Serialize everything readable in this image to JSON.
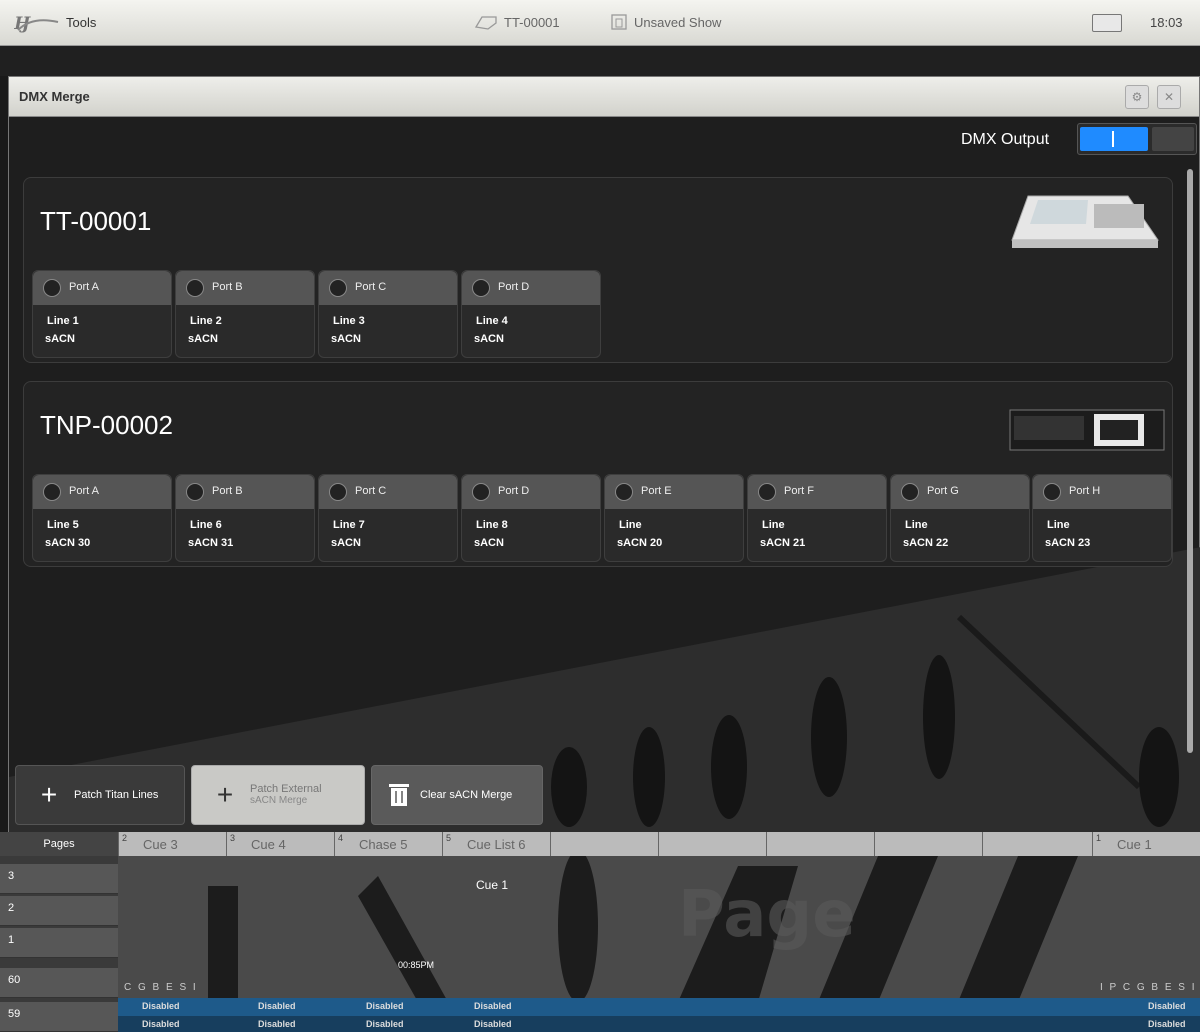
{
  "topbar": {
    "tools_label": "Tools",
    "console_name": "TT-00001",
    "show_name": "Unsaved Show",
    "clock": "18:03"
  },
  "window": {
    "title": "DMX Merge",
    "dmx_output_label": "DMX Output",
    "dmx_output_on": true
  },
  "devices": [
    {
      "name": "TT-00001",
      "ports": [
        {
          "port": "Port A",
          "line": "Line 1",
          "sub": "sACN"
        },
        {
          "port": "Port B",
          "line": "Line 2",
          "sub": "sACN"
        },
        {
          "port": "Port C",
          "line": "Line 3",
          "sub": "sACN"
        },
        {
          "port": "Port D",
          "line": "Line 4",
          "sub": "sACN"
        }
      ]
    },
    {
      "name": "TNP-00002",
      "ports": [
        {
          "port": "Port A",
          "line": "Line 5",
          "sub": "sACN 30"
        },
        {
          "port": "Port B",
          "line": "Line 6",
          "sub": "sACN 31"
        },
        {
          "port": "Port C",
          "line": "Line 7",
          "sub": "sACN"
        },
        {
          "port": "Port D",
          "line": "Line 8",
          "sub": "sACN"
        },
        {
          "port": "Port E",
          "line": "Line",
          "sub": "sACN 20"
        },
        {
          "port": "Port F",
          "line": "Line",
          "sub": "sACN 21"
        },
        {
          "port": "Port G",
          "line": "Line",
          "sub": "sACN 22"
        },
        {
          "port": "Port H",
          "line": "Line",
          "sub": "sACN 23"
        }
      ]
    }
  ],
  "function_buttons": {
    "patch_titan_lines": "Patch Titan Lines",
    "patch_external": "Patch External",
    "patch_external_sub": "sACN Merge",
    "clear_sacn_merge": "Clear sACN Merge"
  },
  "playbacks": {
    "pages_label": "Pages",
    "headers": [
      {
        "num": "2",
        "label": "Cue 3"
      },
      {
        "num": "3",
        "label": "Cue 4"
      },
      {
        "num": "4",
        "label": "Chase 5"
      },
      {
        "num": "5",
        "label": "Cue List 6"
      },
      {
        "num": "",
        "label": ""
      },
      {
        "num": "",
        "label": ""
      },
      {
        "num": "",
        "label": ""
      },
      {
        "num": "",
        "label": ""
      },
      {
        "num": "",
        "label": ""
      },
      {
        "num": "1",
        "label": "Cue 1"
      }
    ],
    "page_numbers": [
      "3",
      "2",
      "1",
      "60",
      "59"
    ],
    "cue_label": "Cue 1",
    "time_label": "00:85PM",
    "fpletters_1": "C G B E S I",
    "fpletters_2": "I P C G B E S I",
    "disabled_label": "Disabled"
  },
  "colors": {
    "accent_blue": "#1f8bff",
    "panel_bg": "#232323",
    "port_header": "#555555"
  }
}
